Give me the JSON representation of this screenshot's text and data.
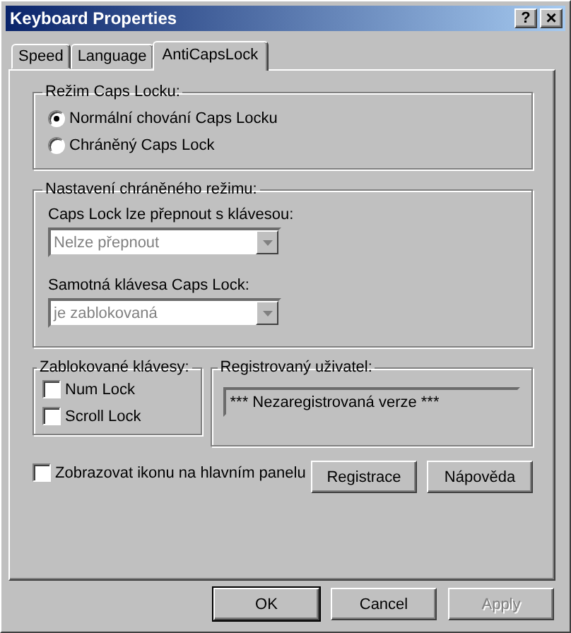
{
  "window": {
    "title": "Keyboard Properties",
    "help": "?",
    "close": "×"
  },
  "tabs": [
    {
      "label": "Speed",
      "selected": false
    },
    {
      "label": "Language",
      "selected": false
    },
    {
      "label": "AntiCapsLock",
      "selected": true
    }
  ],
  "caps_mode": {
    "label": "Režim Caps Locku:",
    "options": [
      {
        "label": "Normální chování Caps Locku",
        "selected": true
      },
      {
        "label": "Chráněný Caps Lock",
        "selected": false
      }
    ]
  },
  "protected_mode": {
    "label": "Nastavení chráněného režimu:",
    "fields": [
      {
        "label": "Caps Lock lze přepnout s klávesou:",
        "value": "Nelze přepnout",
        "disabled": true
      },
      {
        "label": "Samotná klávesa Caps Lock:",
        "value": "je zablokovaná",
        "disabled": true
      }
    ]
  },
  "blocked_keys": {
    "label": "Zablokované klávesy:",
    "options": [
      {
        "label": "Num Lock",
        "checked": false
      },
      {
        "label": "Scroll Lock",
        "checked": false
      }
    ]
  },
  "registered_user": {
    "label": "Registrovaný uživatel:",
    "value": "*** Nezaregistrovaná verze ***"
  },
  "show_icon": {
    "label": "Zobrazovat ikonu na hlavním panelu",
    "checked": false
  },
  "actions": [
    {
      "label": "Registrace",
      "disabled": false
    },
    {
      "label": "Nápověda",
      "disabled": false
    }
  ],
  "buttons": [
    {
      "label": "OK",
      "disabled": false
    },
    {
      "label": "Cancel",
      "disabled": false
    },
    {
      "label": "Apply",
      "disabled": true
    }
  ]
}
